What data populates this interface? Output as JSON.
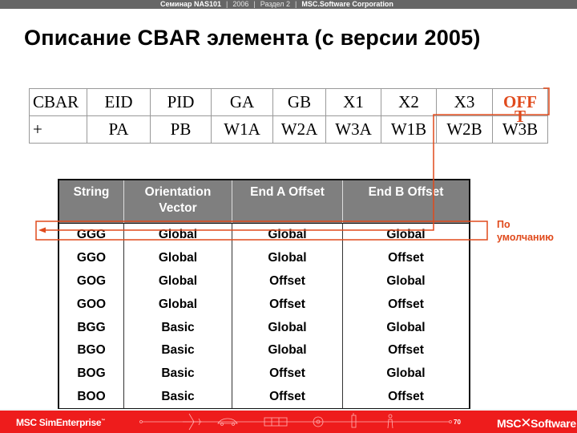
{
  "header": {
    "seminar": "Семинар NAS101",
    "year": "2006",
    "section": "Раздел  2",
    "company": "MSC.Software Corporation"
  },
  "title": "Описание CBAR элемента (с версии 2005)",
  "card": {
    "rows": [
      [
        "CBAR",
        "EID",
        "PID",
        "GA",
        "GB",
        "X1",
        "X2",
        "X3",
        "OFFT"
      ],
      [
        "+",
        "PA",
        "PB",
        "W1A",
        "W2A",
        "W3A",
        "W1B",
        "W2B",
        "W3B"
      ]
    ],
    "offt_line1": "OFF",
    "offt_line2": "T"
  },
  "options_table": {
    "headers": [
      "String",
      "Orientation Vector",
      "End A Offset",
      "End B Offset"
    ],
    "header_lines": [
      [
        "String"
      ],
      [
        "Orientation",
        "Vector"
      ],
      [
        "End A Offset"
      ],
      [
        "End B Offset"
      ]
    ],
    "rows": [
      [
        "GGG",
        "Global",
        "Global",
        "Global"
      ],
      [
        "GGO",
        "Global",
        "Global",
        "Offset"
      ],
      [
        "GOG",
        "Global",
        "Offset",
        "Global"
      ],
      [
        "GOO",
        "Global",
        "Offset",
        "Offset"
      ],
      [
        "BGG",
        "Basic",
        "Global",
        "Global"
      ],
      [
        "BGO",
        "Basic",
        "Global",
        "Offset"
      ],
      [
        "BOG",
        "Basic",
        "Offset",
        "Global"
      ],
      [
        "BOO",
        "Basic",
        "Offset",
        "Offset"
      ]
    ],
    "highlighted_row": "GGG"
  },
  "annotation": {
    "line1": "По",
    "line2": "умолчанию",
    "color": "#e04a1c"
  },
  "footer": {
    "brand_left": "MSC SimEnterprise",
    "brand_left_tm": "™",
    "page_number": "70",
    "brand_right_a": "MSC",
    "brand_right_x": "✕",
    "brand_right_b": "Software",
    "background": "#ee1c1c"
  },
  "colors": {
    "accent": "#e04a1c",
    "table_header_bg": "#7f7f7f",
    "topbar_bg": "#666666"
  }
}
